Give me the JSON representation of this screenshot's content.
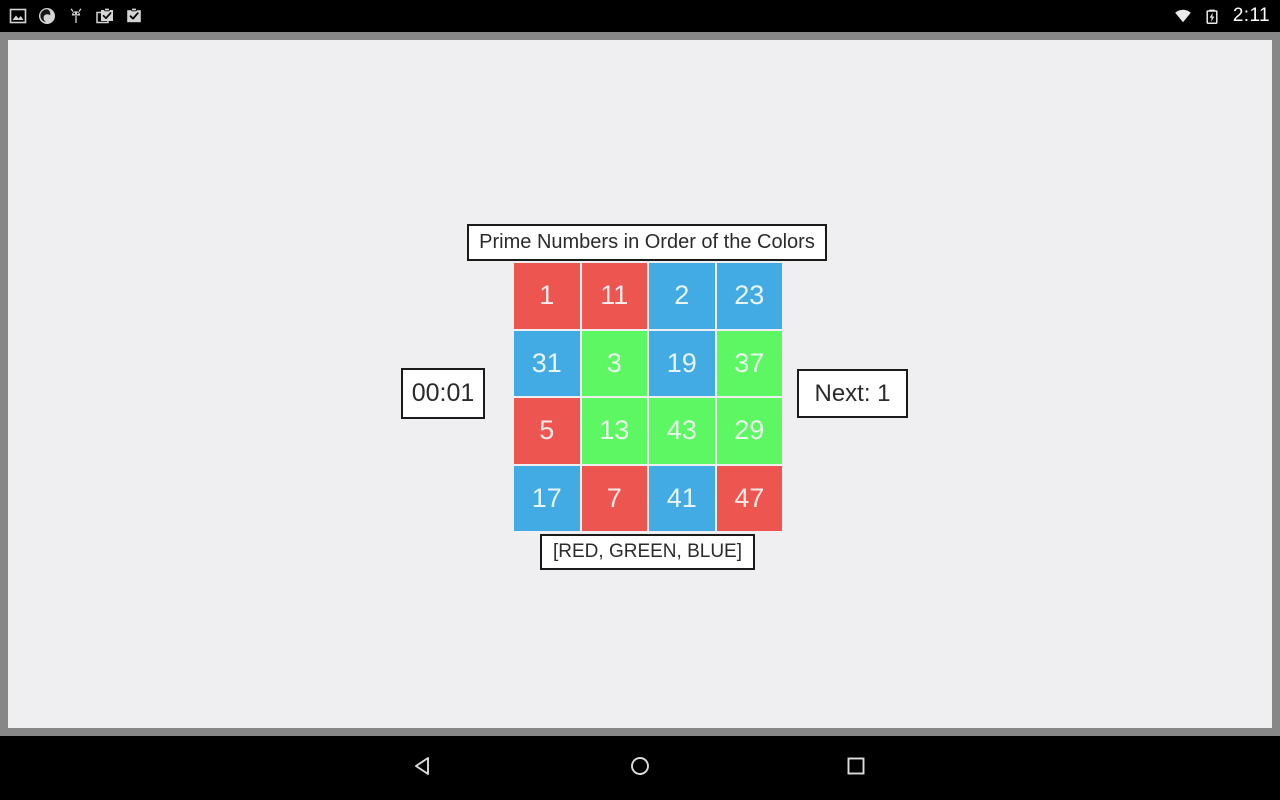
{
  "status_bar": {
    "clock": "2:11",
    "left_icons": [
      {
        "name": "image-icon",
        "label": "Screenshot"
      },
      {
        "name": "firefox-icon",
        "label": "Firefox"
      },
      {
        "name": "android-bug-icon",
        "label": "Android Debug"
      },
      {
        "name": "clipboard-check-icon",
        "label": "Task Complete"
      },
      {
        "name": "clipboard-check-alt-icon",
        "label": "Task Complete"
      }
    ],
    "right_icons": [
      {
        "name": "wifi-icon",
        "label": "Wi-Fi"
      },
      {
        "name": "battery-charging-icon",
        "label": "Battery Charging"
      }
    ]
  },
  "app": {
    "title": "Prime Numbers in Order of the Colors",
    "timer": "00:01",
    "next_label": "Next: 1",
    "color_order": "[RED, GREEN, BLUE]",
    "colors": {
      "red": "#ec5550",
      "green": "#5cf762",
      "blue": "#42abe3",
      "background": "#efeff2",
      "window_chrome": "#878787"
    },
    "grid": {
      "rows": 4,
      "cols": 4,
      "tiles": [
        {
          "value": "1",
          "color": "red"
        },
        {
          "value": "11",
          "color": "red"
        },
        {
          "value": "2",
          "color": "blue"
        },
        {
          "value": "23",
          "color": "blue"
        },
        {
          "value": "31",
          "color": "blue"
        },
        {
          "value": "3",
          "color": "green"
        },
        {
          "value": "19",
          "color": "blue"
        },
        {
          "value": "37",
          "color": "green"
        },
        {
          "value": "5",
          "color": "red"
        },
        {
          "value": "13",
          "color": "green"
        },
        {
          "value": "43",
          "color": "green"
        },
        {
          "value": "29",
          "color": "green"
        },
        {
          "value": "17",
          "color": "blue"
        },
        {
          "value": "7",
          "color": "red"
        },
        {
          "value": "41",
          "color": "blue"
        },
        {
          "value": "47",
          "color": "red"
        }
      ]
    }
  },
  "nav_bar": {
    "back_label": "Back",
    "home_label": "Home",
    "recents_label": "Recent Apps"
  }
}
